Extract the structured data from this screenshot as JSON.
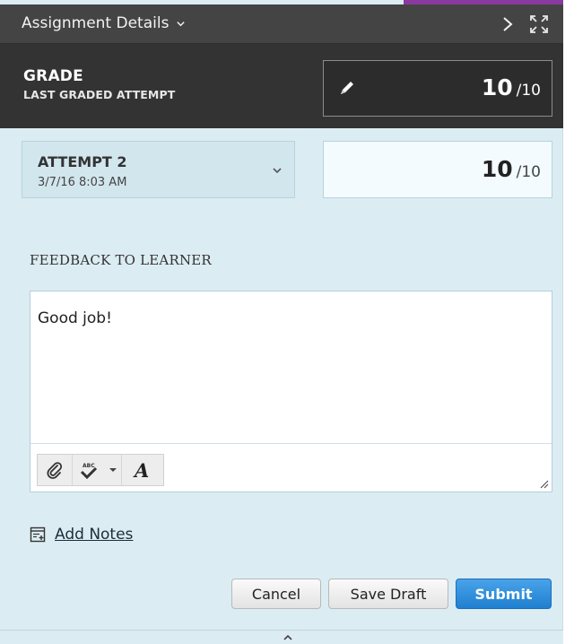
{
  "header": {
    "title": "Assignment Details",
    "icons": [
      "chevron-down-icon",
      "chevron-right-icon",
      "expand-icon"
    ]
  },
  "grade": {
    "title": "GRADE",
    "subtitle": "LAST GRADED ATTEMPT",
    "score": "10",
    "max": "/10",
    "icon": "pencil-icon"
  },
  "attempt": {
    "label": "ATTEMPT 2",
    "date": "3/7/16 8:03 AM",
    "score": "10",
    "max": "/10"
  },
  "feedback": {
    "label": "FEEDBACK TO LEARNER",
    "text": "Good job!",
    "toolbar_icons": [
      "paperclip-icon",
      "spellcheck-icon",
      "dropdown-arrow-icon",
      "font-style-icon"
    ]
  },
  "notes": {
    "label": "Add Notes",
    "icon": "add-note-icon"
  },
  "buttons": {
    "cancel": "Cancel",
    "save_draft": "Save Draft",
    "submit": "Submit"
  },
  "colors": {
    "panel_bg": "#dcecf3",
    "header_bg": "#444444",
    "grade_bg": "#333333",
    "accent": "#8a3a9e",
    "submit_bg": "#2a8ddd"
  }
}
